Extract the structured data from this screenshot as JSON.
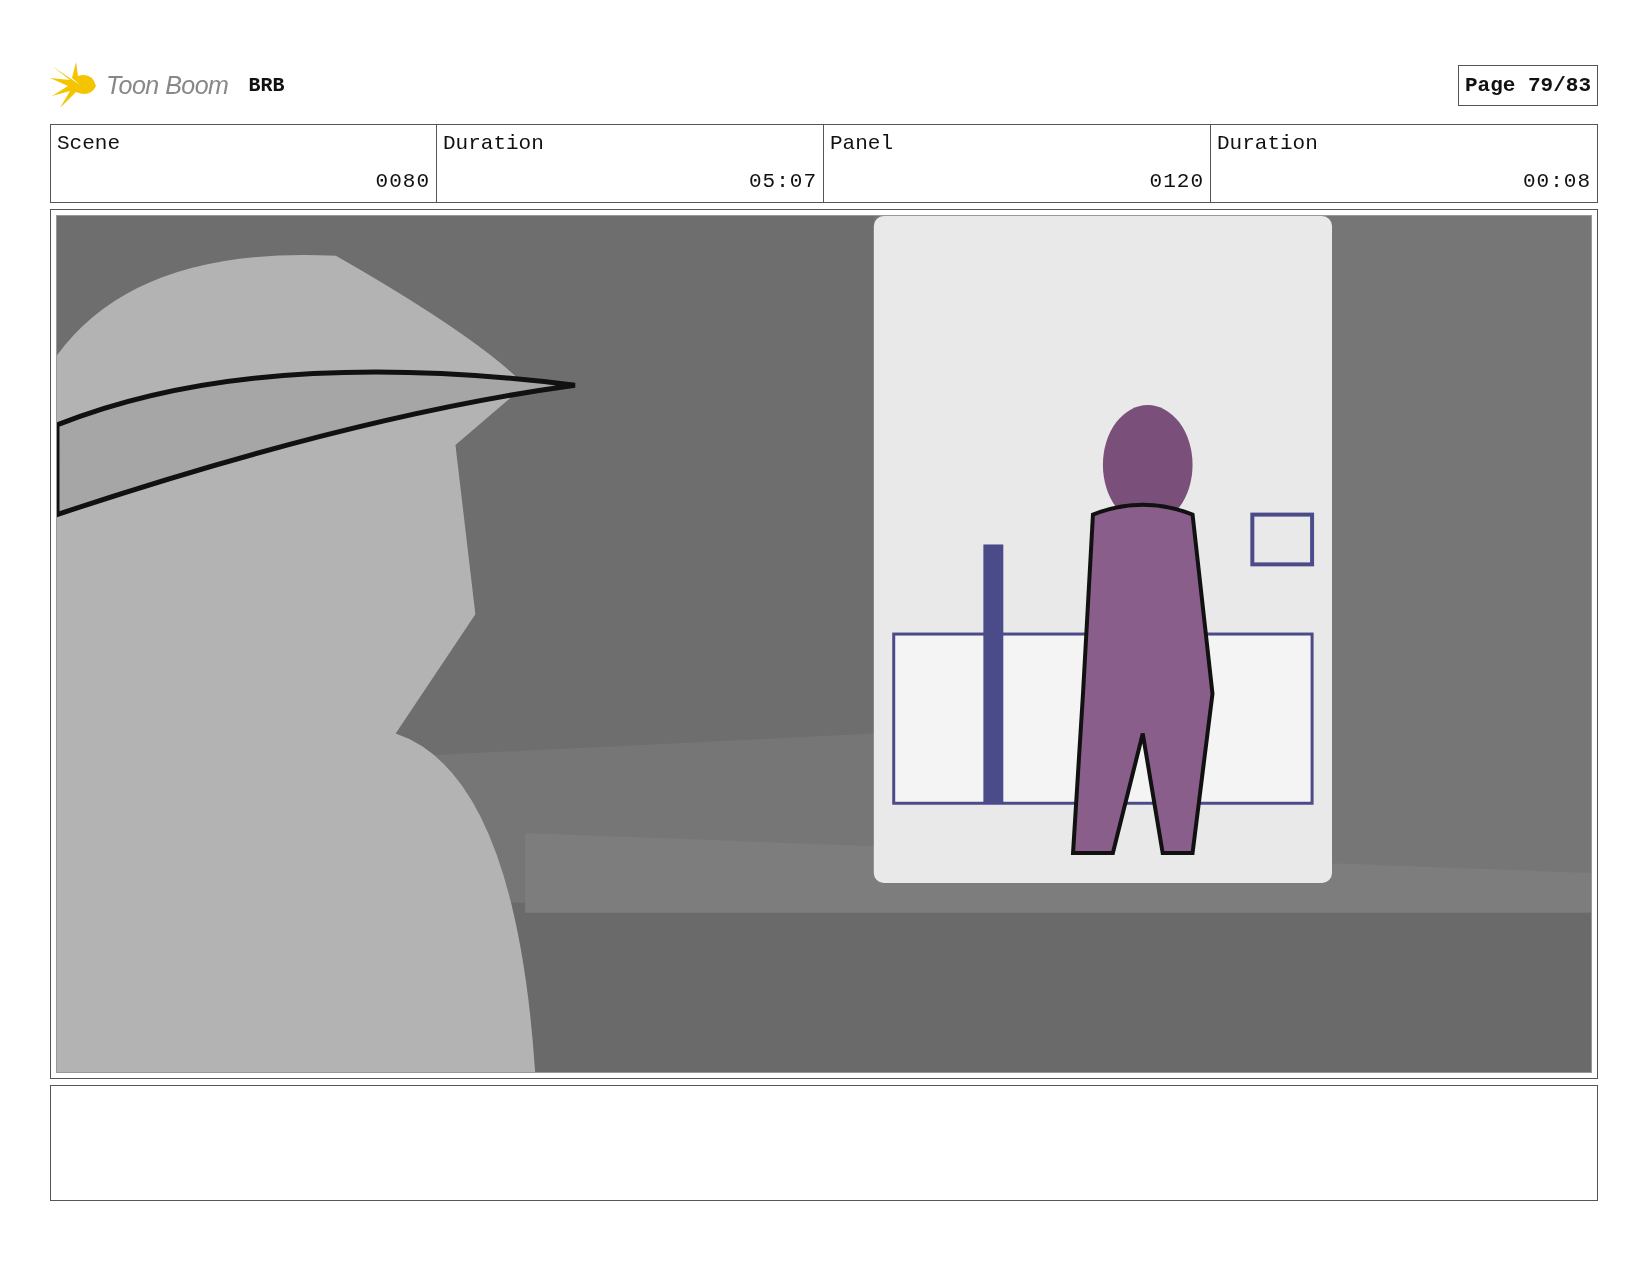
{
  "header": {
    "logo_text": "Toon Boom",
    "project": "BRB",
    "page": "Page 79/83"
  },
  "info_table": {
    "columns": [
      "Scene",
      "Duration",
      "Panel",
      "Duration"
    ],
    "row": [
      "0080",
      "05:07",
      "0120",
      "00:08"
    ]
  }
}
